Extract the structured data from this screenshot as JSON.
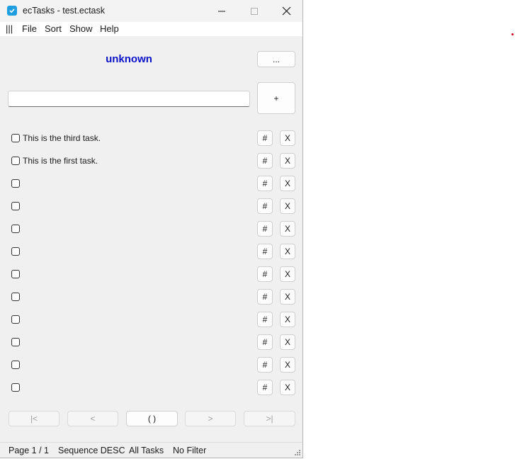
{
  "window": {
    "title": "ecTasks - test.ectask"
  },
  "menu": [
    "|||",
    "File",
    "Sort",
    "Show",
    "Help"
  ],
  "header": {
    "title": "unknown",
    "more_label": "...",
    "add_label": "+"
  },
  "new_task": {
    "value": "",
    "placeholder": ""
  },
  "tasks": [
    {
      "text": "This is the third task.",
      "checked": false,
      "edit_label": "#",
      "delete_label": "X"
    },
    {
      "text": "This is the first task.",
      "checked": false,
      "edit_label": "#",
      "delete_label": "X"
    },
    {
      "text": "",
      "checked": false,
      "edit_label": "#",
      "delete_label": "X"
    },
    {
      "text": "",
      "checked": false,
      "edit_label": "#",
      "delete_label": "X"
    },
    {
      "text": "",
      "checked": false,
      "edit_label": "#",
      "delete_label": "X"
    },
    {
      "text": "",
      "checked": false,
      "edit_label": "#",
      "delete_label": "X"
    },
    {
      "text": "",
      "checked": false,
      "edit_label": "#",
      "delete_label": "X"
    },
    {
      "text": "",
      "checked": false,
      "edit_label": "#",
      "delete_label": "X"
    },
    {
      "text": "",
      "checked": false,
      "edit_label": "#",
      "delete_label": "X"
    },
    {
      "text": "",
      "checked": false,
      "edit_label": "#",
      "delete_label": "X"
    },
    {
      "text": "",
      "checked": false,
      "edit_label": "#",
      "delete_label": "X"
    },
    {
      "text": "",
      "checked": false,
      "edit_label": "#",
      "delete_label": "X"
    }
  ],
  "pager": {
    "first": "|<",
    "prev": "<",
    "current": "( )",
    "next": ">",
    "last": ">|"
  },
  "status": {
    "page": "Page 1 / 1",
    "sort": "Sequence DESC",
    "view": "All Tasks",
    "filter": "No Filter"
  },
  "colors": {
    "headline": "#0a12c8",
    "app_icon": "#1e9de0",
    "window_bg": "#f0f0f0"
  }
}
